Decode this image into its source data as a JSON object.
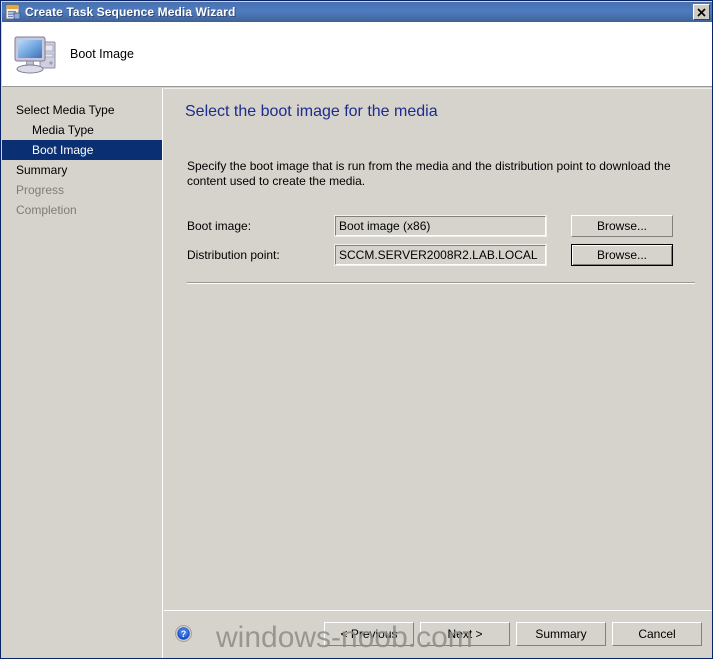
{
  "window": {
    "title": "Create Task Sequence Media Wizard",
    "close_label": "✕",
    "title_icon": "wizard-icon"
  },
  "header": {
    "title": "Boot Image",
    "icon": "computer-icon"
  },
  "sidebar": {
    "items": [
      {
        "label": "Select Media Type",
        "level": 0,
        "state": "normal"
      },
      {
        "label": "Media Type",
        "level": 1,
        "state": "normal"
      },
      {
        "label": "Boot Image",
        "level": 1,
        "state": "selected"
      },
      {
        "label": "Summary",
        "level": 0,
        "state": "normal"
      },
      {
        "label": "Progress",
        "level": 0,
        "state": "disabled"
      },
      {
        "label": "Completion",
        "level": 0,
        "state": "disabled"
      }
    ]
  },
  "content": {
    "heading": "Select the boot image for the media",
    "description": "Specify the boot image that is run from the media and the distribution point to download the content used to create the media.",
    "fields": [
      {
        "label": "Boot image:",
        "value": "Boot image (x86)",
        "button_label": "Browse...",
        "button_focused": false
      },
      {
        "label": "Distribution point:",
        "value": "SCCM.SERVER2008R2.LAB.LOCAL",
        "button_label": "Browse...",
        "button_focused": true
      }
    ]
  },
  "footer": {
    "help_icon": "help-question-icon",
    "buttons": [
      {
        "label": "< Previous"
      },
      {
        "label": "Next >"
      },
      {
        "label": "Summary"
      },
      {
        "label": "Cancel"
      }
    ]
  },
  "watermark": {
    "text": "windows-noob.com"
  },
  "colors": {
    "titlebar_blue": "#4a76b8",
    "dialog_face": "#d6d3cc",
    "heading_blue": "#1c2c8c",
    "selection_navy": "#0a2f72",
    "disabled_text": "#7d7d78"
  }
}
